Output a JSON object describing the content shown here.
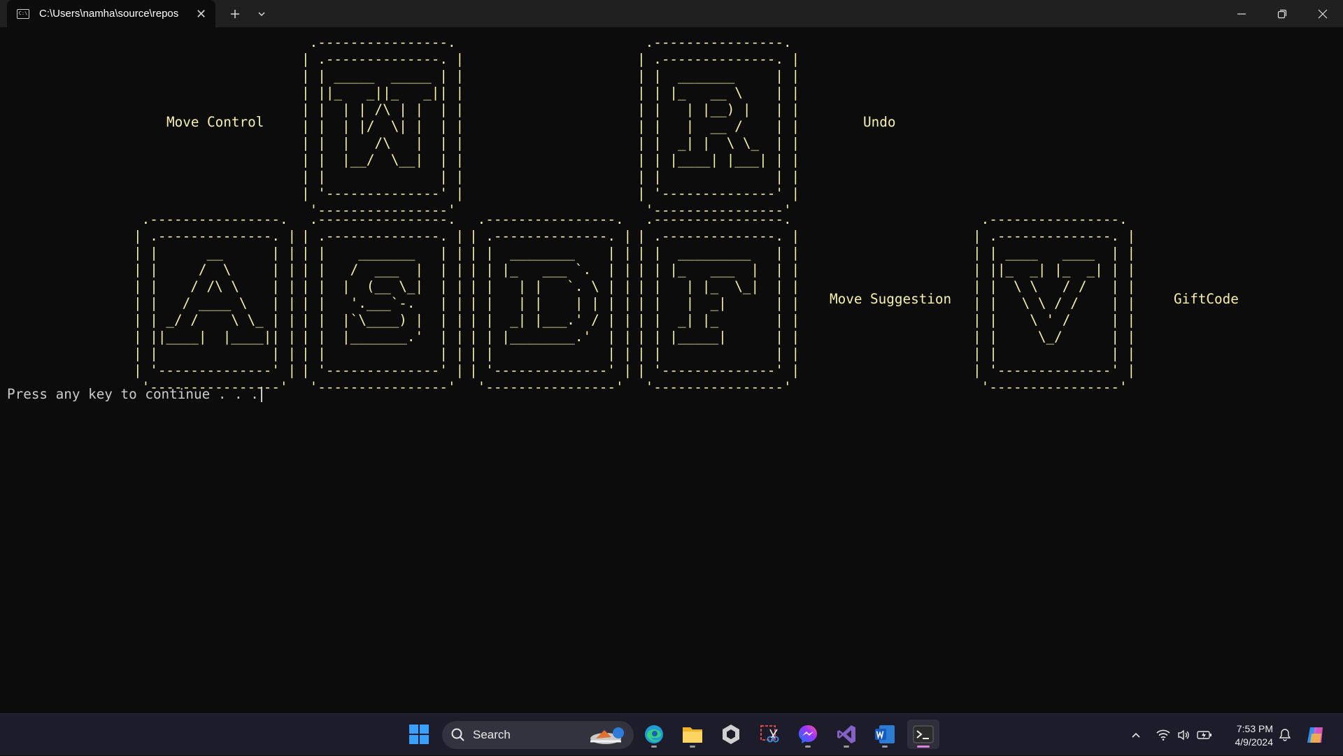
{
  "window": {
    "tab_title": "C:\\Users\\namha\\source\\repos",
    "tab_icon_glyph": "C:\\",
    "accent": "#f9f1a5"
  },
  "art": {
    "W": [
      " .----------------. ",
      "| .--------------. |",
      "| | _____  _____ | |",
      "| ||_   _||_   _|| |",
      "| |  | | /\\ | |  | |",
      "| |  | |/  \\| |  | |",
      "| |  |   /\\   |  | |",
      "| |  |__/  \\__|  | |",
      "| |              | |",
      "| '--------------' |",
      " '----------------' "
    ],
    "R": [
      " .----------------. ",
      "| .--------------. |",
      "| |  _______     | |",
      "| | |_   __ \\    | |",
      "| |   | |__) |   | |",
      "| |   |  __ /    | |",
      "| |  _| |  \\ \\_  | |",
      "| | |____| |___| | |",
      "| |              | |",
      "| '--------------' |",
      " '----------------' "
    ],
    "A": [
      " .----------------. ",
      "| .--------------. |",
      "| |      __      | |",
      "| |     /  \\     | |",
      "| |    / /\\ \\    | |",
      "| |   / ____ \\   | |",
      "| | _/ /    \\ \\_ | |",
      "| ||____|  |____|| |",
      "| |              | |",
      "| '--------------' |",
      " '----------------' "
    ],
    "S": [
      " .----------------. ",
      "| .--------------. |",
      "| |    _______   | |",
      "| |   /  ___  |  | |",
      "| |  |  (__ \\_|  | |",
      "| |   '.___`-.   | |",
      "| |  |`\\____) |  | |",
      "| |  |_______.'  | |",
      "| |              | |",
      "| '--------------' |",
      " '----------------' "
    ],
    "D": [
      " .----------------. ",
      "| .--------------. |",
      "| |  ________    | |",
      "| | |_   ___ `.  | |",
      "| |   | |   `. \\ | |",
      "| |   | |    | | | |",
      "| |  _| |___.' / | |",
      "| | |________.'  | |",
      "| |              | |",
      "| '--------------' |",
      " '----------------' "
    ],
    "F": [
      " .----------------. ",
      "| .--------------. |",
      "| |  _________   | |",
      "| | |_   ___  |  | |",
      "| |   | |_  \\_|  | |",
      "| |   |  _|      | |",
      "| |  _| |_       | |",
      "| | |_____|      | |",
      "| |              | |",
      "| '--------------' |",
      " '----------------' "
    ],
    "V": [
      " .----------------. ",
      "| .--------------. |",
      "| | ____   ____  | |",
      "| ||_  _| |_  _| | |",
      "| |  \\ \\   / /   | |",
      "| |   \\ \\ / /    | |",
      "| |    \\ ' /     | |",
      "| |     \\_/      | |",
      "| |              | |",
      "| '--------------' |",
      " '----------------' "
    ]
  },
  "labels": {
    "move_control": "Move Control",
    "undo": "Undo",
    "move_suggestion": "Move Suggestion",
    "giftcode": "GiftCode"
  },
  "prompt": "Press any key to continue . . .",
  "taskbar": {
    "search_label": "Search",
    "pinned": [
      "windows-start",
      "edge",
      "file-explorer",
      "unity-hub",
      "snipping-tool",
      "messenger",
      "visual-studio",
      "word",
      "terminal"
    ],
    "time": "7:53 PM",
    "date": "4/9/2024"
  }
}
